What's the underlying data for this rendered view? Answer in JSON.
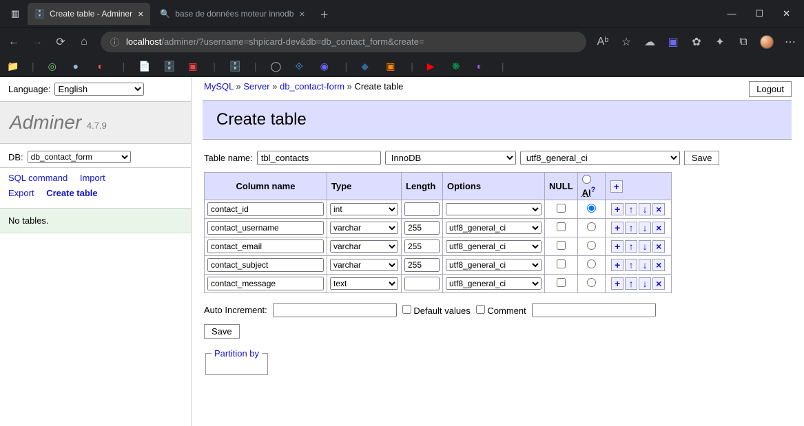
{
  "browser": {
    "tabs": [
      {
        "title": "Create table - Adminer",
        "active": true
      },
      {
        "title": "base de données moteur innodb",
        "active": false
      }
    ],
    "url_prefix": "localhost",
    "url_path": "/adminer/?username=shpicard-dev&db=db_contact_form&create="
  },
  "sidebar": {
    "language_label": "Language:",
    "language_value": "English",
    "brand": "Adminer",
    "version": "4.7.9",
    "db_label": "DB:",
    "db_value": "db_contact_form",
    "links": {
      "sql_command": "SQL command",
      "import": "Import",
      "export": "Export",
      "create_table": "Create table"
    },
    "no_tables": "No tables."
  },
  "breadcrumb": {
    "mysql": "MySQL",
    "server": "Server",
    "db": "db_contact-form",
    "current": "Create table"
  },
  "logout_label": "Logout",
  "page_title": "Create table",
  "table_form": {
    "table_name_label": "Table name:",
    "table_name_value": "tbl_contacts",
    "engine_value": "InnoDB",
    "collation_value": "utf8_general_ci",
    "save_label": "Save"
  },
  "columns_header": {
    "name": "Column name",
    "type": "Type",
    "length": "Length",
    "options": "Options",
    "null": "NULL",
    "ai": "AI",
    "ai_help": "?",
    "add": "+"
  },
  "columns": [
    {
      "name": "contact_id",
      "type": "int",
      "length": "",
      "options": "",
      "null": false,
      "ai": true
    },
    {
      "name": "contact_username",
      "type": "varchar",
      "length": "255",
      "options": "utf8_general_ci",
      "null": false,
      "ai": false
    },
    {
      "name": "contact_email",
      "type": "varchar",
      "length": "255",
      "options": "utf8_general_ci",
      "null": false,
      "ai": false
    },
    {
      "name": "contact_subject",
      "type": "varchar",
      "length": "255",
      "options": "utf8_general_ci",
      "null": false,
      "ai": false
    },
    {
      "name": "contact_message",
      "type": "text",
      "length": "",
      "options": "utf8_general_ci",
      "null": false,
      "ai": false
    }
  ],
  "bottom": {
    "auto_increment_label": "Auto Increment:",
    "auto_increment_value": "",
    "default_values_label": "Default values",
    "comment_label": "Comment",
    "comment_value": "",
    "save_label": "Save",
    "partition_label": "Partition by"
  }
}
